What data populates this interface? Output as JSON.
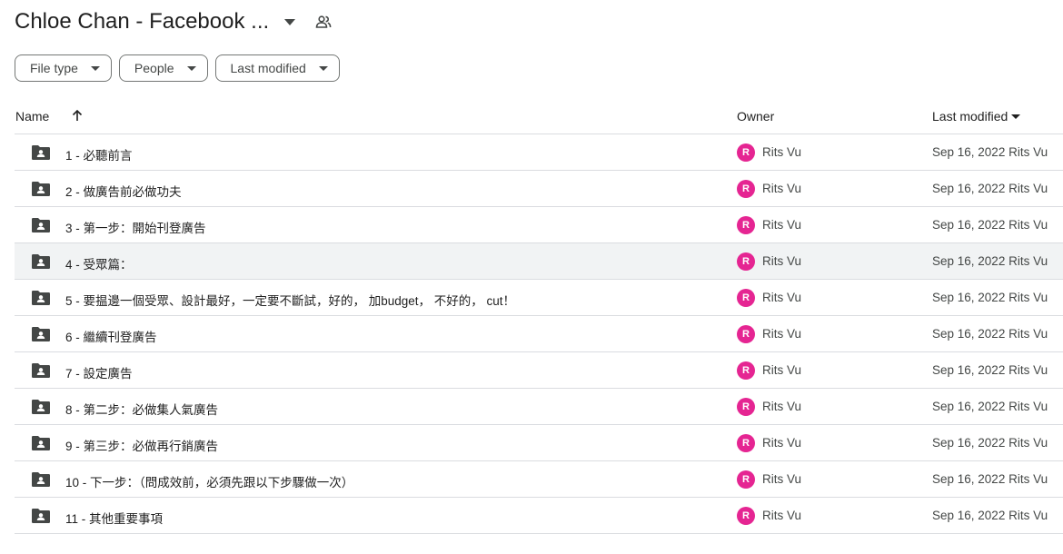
{
  "header": {
    "title": "Chloe Chan - Facebook ...",
    "caret_icon": "arrow-drop-down-icon",
    "shared_icon": "people-icon"
  },
  "filters": [
    {
      "label": "File type"
    },
    {
      "label": "People"
    },
    {
      "label": "Last modified"
    }
  ],
  "columns": {
    "name": "Name",
    "owner": "Owner",
    "last_modified": "Last modified",
    "sort_icon": "arrow-upward-icon",
    "modified_sort_icon": "arrow-drop-down-icon"
  },
  "colors": {
    "avatar": "#e52592",
    "folder": "#444746",
    "row_hover": "#f1f3f4"
  },
  "rows": [
    {
      "name": "1 - 必聽前言",
      "owner_initial": "R",
      "owner": "Rits Vu",
      "modified": "Sep 16, 2022 Rits Vu"
    },
    {
      "name": "2 - 做廣告前必做功夫",
      "owner_initial": "R",
      "owner": "Rits Vu",
      "modified": "Sep 16, 2022 Rits Vu"
    },
    {
      "name": "3 - 第一步：開始刊登廣告",
      "owner_initial": "R",
      "owner": "Rits Vu",
      "modified": "Sep 16, 2022 Rits Vu"
    },
    {
      "name": "4 - 受眾篇：",
      "owner_initial": "R",
      "owner": "Rits Vu",
      "modified": "Sep 16, 2022 Rits Vu"
    },
    {
      "name": "5 - 要揾邊一個受眾、設計最好，一定要不斷試，好的， 加budget， 不好的， cut！",
      "owner_initial": "R",
      "owner": "Rits Vu",
      "modified": "Sep 16, 2022 Rits Vu"
    },
    {
      "name": "6 - 繼續刊登廣告",
      "owner_initial": "R",
      "owner": "Rits Vu",
      "modified": "Sep 16, 2022 Rits Vu"
    },
    {
      "name": "7 - 設定廣告",
      "owner_initial": "R",
      "owner": "Rits Vu",
      "modified": "Sep 16, 2022 Rits Vu"
    },
    {
      "name": "8 - 第二步：必做集人氣廣告",
      "owner_initial": "R",
      "owner": "Rits Vu",
      "modified": "Sep 16, 2022 Rits Vu"
    },
    {
      "name": "9 - 第三步：必做再行銷廣告",
      "owner_initial": "R",
      "owner": "Rits Vu",
      "modified": "Sep 16, 2022 Rits Vu"
    },
    {
      "name": "10 - 下一步：（問成效前，必須先跟以下步驟做一次）",
      "owner_initial": "R",
      "owner": "Rits Vu",
      "modified": "Sep 16, 2022 Rits Vu"
    },
    {
      "name": "11 - 其他重要事項",
      "owner_initial": "R",
      "owner": "Rits Vu",
      "modified": "Sep 16, 2022 Rits Vu"
    }
  ]
}
